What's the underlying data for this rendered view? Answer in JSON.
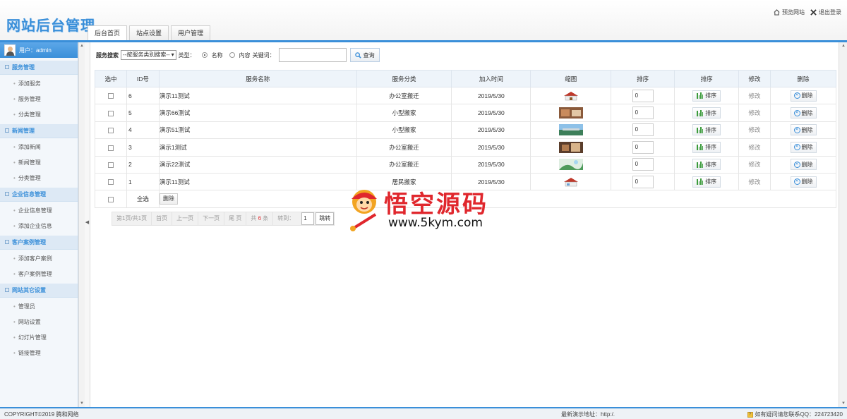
{
  "header": {
    "logo": "网站后台管理",
    "tabs": [
      "后台首页",
      "站点设置",
      "用户管理"
    ],
    "preview_label": "预览网站",
    "logout_label": "退出登录"
  },
  "sidebar": {
    "user_label": "用户：admin",
    "groups": [
      {
        "title": "服务管理",
        "items": [
          "添加服务",
          "服务管理",
          "分类管理"
        ]
      },
      {
        "title": "新闻管理",
        "items": [
          "添加新闻",
          "新闻管理",
          "分类管理"
        ]
      },
      {
        "title": "企业信息管理",
        "items": [
          "企业信息管理",
          "添加企业信息"
        ]
      },
      {
        "title": "客户案例管理",
        "items": [
          "添加客户案例",
          "客户案例管理"
        ]
      },
      {
        "title": "网站其它设置",
        "items": [
          "管理员",
          "网站设置",
          "幻灯片管理",
          "链接管理"
        ]
      }
    ]
  },
  "search": {
    "label": "服务搜索",
    "category_select": "--按服务类别搜索--",
    "type_label": "类型：",
    "radio_name": "名称",
    "radio_content": "内容",
    "keyword_label": "关键词：",
    "query_button": "查询"
  },
  "table": {
    "headers": [
      "选中",
      "ID号",
      "服务名称",
      "服务分类",
      "加入时间",
      "缩图",
      "排序",
      "排序",
      "修改",
      "删除"
    ],
    "rows": [
      {
        "id": "6",
        "name": "演示11测试",
        "category": "办公室搬迁",
        "date": "2019/5/30",
        "sort": "0",
        "sort_btn": "排序",
        "edit": "修改",
        "delete": "删除"
      },
      {
        "id": "5",
        "name": "演示66测试",
        "category": "小型搬家",
        "date": "2019/5/30",
        "sort": "0",
        "sort_btn": "排序",
        "edit": "修改",
        "delete": "删除"
      },
      {
        "id": "4",
        "name": "演示51测试",
        "category": "小型搬家",
        "date": "2019/5/30",
        "sort": "0",
        "sort_btn": "排序",
        "edit": "修改",
        "delete": "删除"
      },
      {
        "id": "3",
        "name": "演示1测试",
        "category": "办公室搬迁",
        "date": "2019/5/30",
        "sort": "0",
        "sort_btn": "排序",
        "edit": "修改",
        "delete": "删除"
      },
      {
        "id": "2",
        "name": "演示22测试",
        "category": "办公室搬迁",
        "date": "2019/5/30",
        "sort": "0",
        "sort_btn": "排序",
        "edit": "修改",
        "delete": "删除"
      },
      {
        "id": "1",
        "name": "演示11测试",
        "category": "居民搬家",
        "date": "2019/5/30",
        "sort": "0",
        "sort_btn": "排序",
        "edit": "修改",
        "delete": "删除"
      }
    ],
    "select_all": "全选",
    "bulk_delete": "删除"
  },
  "pager": {
    "info": "第1页/共1页",
    "first": "首页",
    "prev": "上一页",
    "next": "下一页",
    "last": "尾 页",
    "total_prefix": "共",
    "total": "6",
    "total_suffix": "条",
    "goto_label": "转到：",
    "goto_value": "1",
    "goto_button": "跳转"
  },
  "watermark": {
    "title": "悟空源码",
    "url": "www.5kym.com"
  },
  "footer": {
    "copyright": "COPYRIGHT©2019 腾和网络",
    "demo": "最新演示地址：http:/.",
    "contact": "如有疑问请您联系QQ：224723420"
  }
}
